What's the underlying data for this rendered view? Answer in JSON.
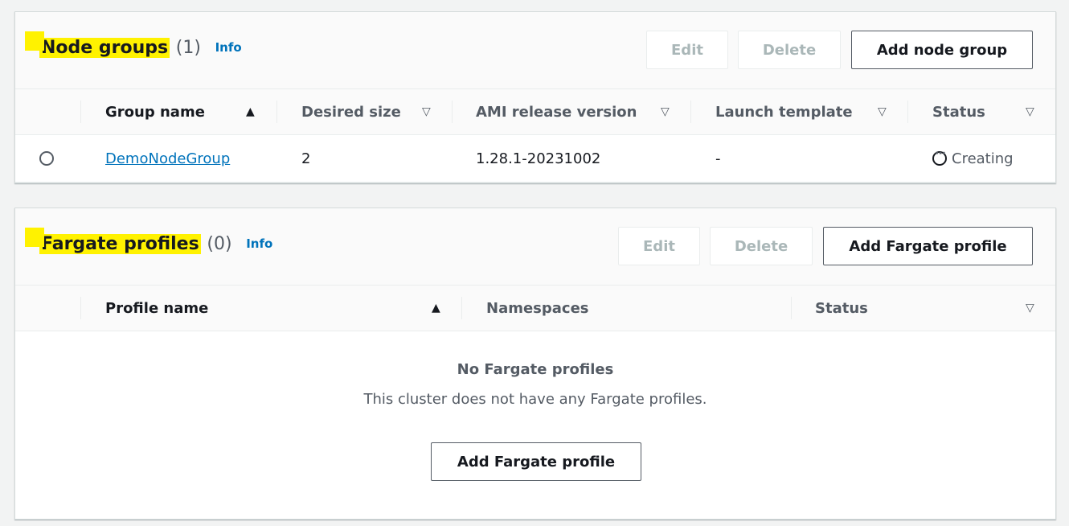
{
  "node_groups": {
    "title": "Node groups",
    "count": "(1)",
    "info": "Info",
    "buttons": {
      "edit": "Edit",
      "delete": "Delete",
      "add": "Add node group"
    },
    "columns": [
      "Group name",
      "Desired size",
      "AMI release version",
      "Launch template",
      "Status"
    ],
    "rows": [
      {
        "group_name": "DemoNodeGroup",
        "desired_size": "2",
        "ami_release_version": "1.28.1-20231002",
        "launch_template": "-",
        "status": "Creating"
      }
    ]
  },
  "fargate": {
    "title": "Fargate profiles",
    "count": "(0)",
    "info": "Info",
    "buttons": {
      "edit": "Edit",
      "delete": "Delete",
      "add": "Add Fargate profile"
    },
    "columns": [
      "Profile name",
      "Namespaces",
      "Status"
    ],
    "empty": {
      "title": "No Fargate profiles",
      "description": "This cluster does not have any Fargate profiles.",
      "button": "Add Fargate profile"
    }
  },
  "colors": {
    "link": "#0073bb",
    "highlight": "#fff200"
  }
}
